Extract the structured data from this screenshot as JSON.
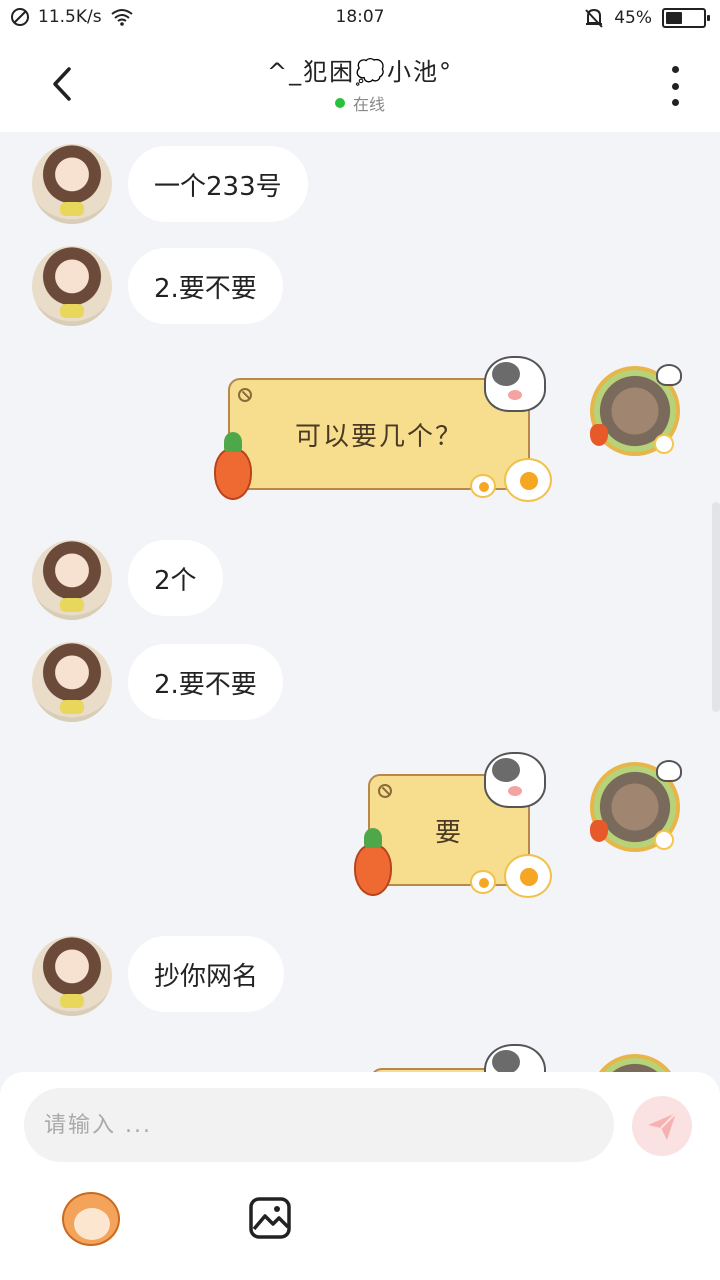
{
  "status_bar": {
    "net_speed": "11.5K/s",
    "time": "18:07",
    "battery_percent": "45%",
    "battery_level": 0.45
  },
  "header": {
    "title": "^_犯困💭小池°",
    "status": "在线"
  },
  "messages": [
    {
      "side": "left",
      "text": "一个233号"
    },
    {
      "side": "left",
      "text": "2.要不要"
    },
    {
      "side": "right",
      "text": "可以要几个？"
    },
    {
      "side": "left",
      "text": "2个"
    },
    {
      "side": "left",
      "text": "2.要不要"
    },
    {
      "side": "right",
      "text": "要"
    },
    {
      "side": "left",
      "text": "抄你网名"
    }
  ],
  "composer": {
    "placeholder": "请输入 ..."
  },
  "icons": {
    "status": [
      "blocked-icon",
      "wifi-icon",
      "mute-bell-icon",
      "battery-icon"
    ],
    "header": [
      "back-arrow-icon",
      "more-vertical-icon"
    ],
    "composer": [
      "send-icon",
      "emoji-sticker-icon",
      "image-icon"
    ]
  }
}
